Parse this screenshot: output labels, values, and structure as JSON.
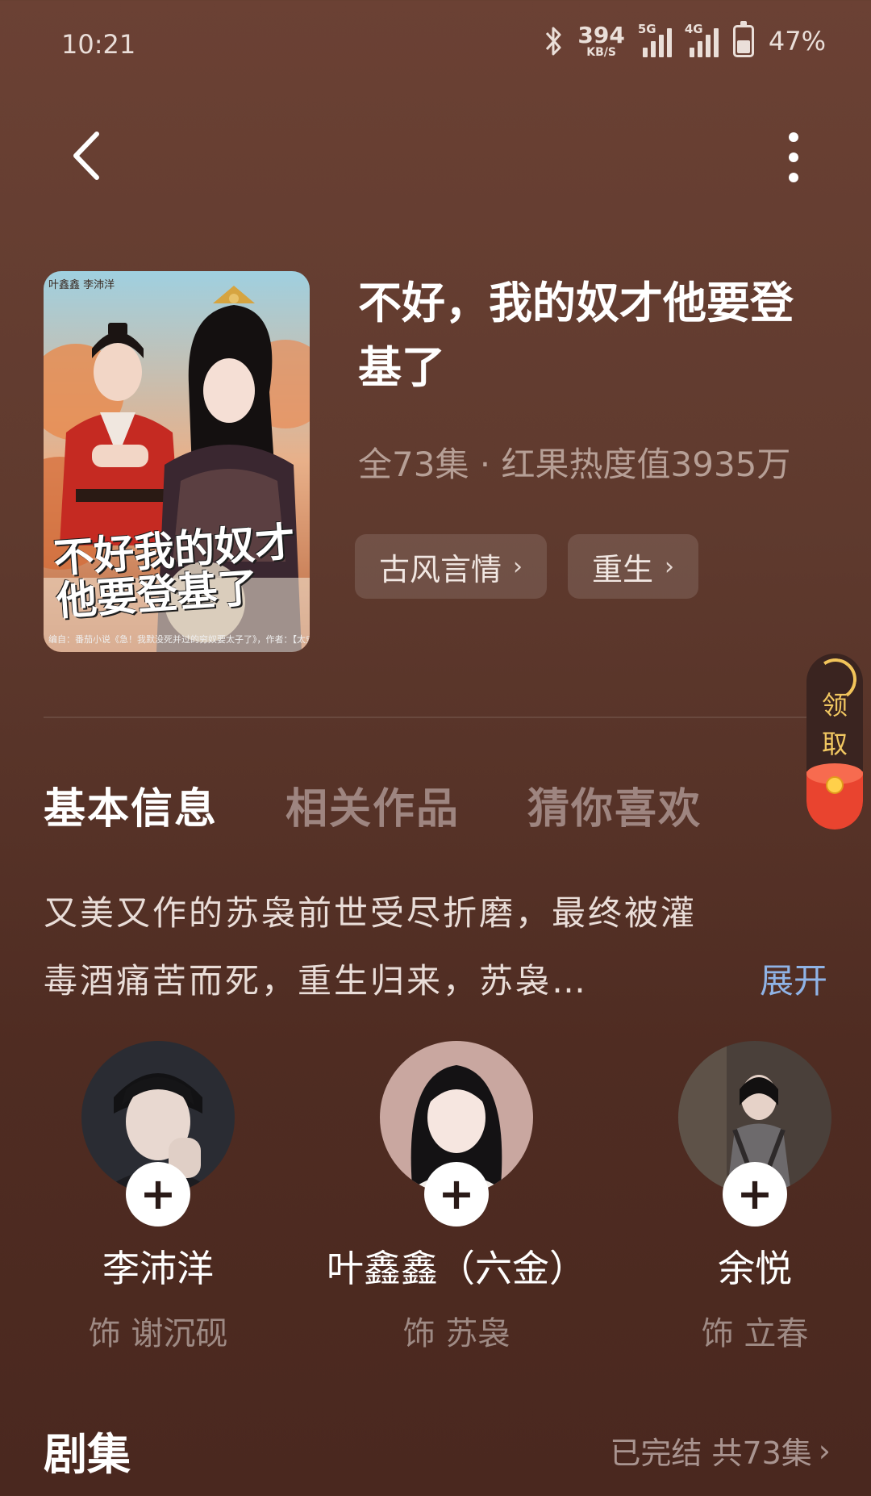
{
  "status_bar": {
    "time": "10:21",
    "net_speed_value": "394",
    "net_speed_unit": "KB/S",
    "sim1_label": "5G",
    "sim2_label": "4G",
    "battery_text": "47%",
    "battery_level": 0.47
  },
  "drama": {
    "title": "不好，我的奴才他要登基了",
    "meta": "全73集 · 红果热度值3935万",
    "tags": [
      {
        "label": "古风言情"
      },
      {
        "label": "重生"
      }
    ],
    "poster": {
      "title_art": "不好我的奴才他要登基了",
      "credit_top": "叶鑫鑫 李沛洋",
      "credit_bottom": "编自：番茄小说《急！我默没死并过的穷奴要太子了》，作者：【太史"
    }
  },
  "reward": {
    "label_1": "领",
    "label_2": "取"
  },
  "tabs": [
    {
      "label": "基本信息",
      "active": true
    },
    {
      "label": "相关作品",
      "active": false
    },
    {
      "label": "猜你喜欢",
      "active": false
    }
  ],
  "synopsis": {
    "line1": "又美又作的苏袅前世受尽折磨，最终被灌",
    "line2": "毒酒痛苦而死，重生归来，苏袅…",
    "expand_label": "展开"
  },
  "cast": [
    {
      "name": "李沛洋",
      "role": "饰 谢沉砚"
    },
    {
      "name": "叶鑫鑫（六金）",
      "role": "饰 苏袅"
    },
    {
      "name": "余悦",
      "role": "饰 立春"
    }
  ],
  "episodes": {
    "title": "剧集",
    "status": "已完结 共73集"
  },
  "colors": {
    "background": "#5f3a2e",
    "accent_link": "#8fb3e6",
    "reward_gold": "#f1c761",
    "reward_red": "#e9442f"
  }
}
